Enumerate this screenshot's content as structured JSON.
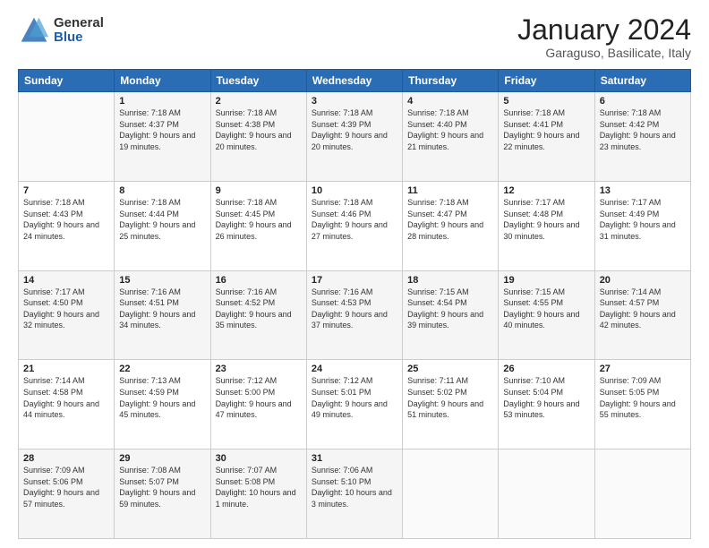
{
  "logo": {
    "general": "General",
    "blue": "Blue"
  },
  "header": {
    "month": "January 2024",
    "location": "Garaguso, Basilicate, Italy"
  },
  "weekdays": [
    "Sunday",
    "Monday",
    "Tuesday",
    "Wednesday",
    "Thursday",
    "Friday",
    "Saturday"
  ],
  "weeks": [
    [
      {
        "day": "",
        "sunrise": "",
        "sunset": "",
        "daylight": ""
      },
      {
        "day": "1",
        "sunrise": "Sunrise: 7:18 AM",
        "sunset": "Sunset: 4:37 PM",
        "daylight": "Daylight: 9 hours and 19 minutes."
      },
      {
        "day": "2",
        "sunrise": "Sunrise: 7:18 AM",
        "sunset": "Sunset: 4:38 PM",
        "daylight": "Daylight: 9 hours and 20 minutes."
      },
      {
        "day": "3",
        "sunrise": "Sunrise: 7:18 AM",
        "sunset": "Sunset: 4:39 PM",
        "daylight": "Daylight: 9 hours and 20 minutes."
      },
      {
        "day": "4",
        "sunrise": "Sunrise: 7:18 AM",
        "sunset": "Sunset: 4:40 PM",
        "daylight": "Daylight: 9 hours and 21 minutes."
      },
      {
        "day": "5",
        "sunrise": "Sunrise: 7:18 AM",
        "sunset": "Sunset: 4:41 PM",
        "daylight": "Daylight: 9 hours and 22 minutes."
      },
      {
        "day": "6",
        "sunrise": "Sunrise: 7:18 AM",
        "sunset": "Sunset: 4:42 PM",
        "daylight": "Daylight: 9 hours and 23 minutes."
      }
    ],
    [
      {
        "day": "7",
        "sunrise": "Sunrise: 7:18 AM",
        "sunset": "Sunset: 4:43 PM",
        "daylight": "Daylight: 9 hours and 24 minutes."
      },
      {
        "day": "8",
        "sunrise": "Sunrise: 7:18 AM",
        "sunset": "Sunset: 4:44 PM",
        "daylight": "Daylight: 9 hours and 25 minutes."
      },
      {
        "day": "9",
        "sunrise": "Sunrise: 7:18 AM",
        "sunset": "Sunset: 4:45 PM",
        "daylight": "Daylight: 9 hours and 26 minutes."
      },
      {
        "day": "10",
        "sunrise": "Sunrise: 7:18 AM",
        "sunset": "Sunset: 4:46 PM",
        "daylight": "Daylight: 9 hours and 27 minutes."
      },
      {
        "day": "11",
        "sunrise": "Sunrise: 7:18 AM",
        "sunset": "Sunset: 4:47 PM",
        "daylight": "Daylight: 9 hours and 28 minutes."
      },
      {
        "day": "12",
        "sunrise": "Sunrise: 7:17 AM",
        "sunset": "Sunset: 4:48 PM",
        "daylight": "Daylight: 9 hours and 30 minutes."
      },
      {
        "day": "13",
        "sunrise": "Sunrise: 7:17 AM",
        "sunset": "Sunset: 4:49 PM",
        "daylight": "Daylight: 9 hours and 31 minutes."
      }
    ],
    [
      {
        "day": "14",
        "sunrise": "Sunrise: 7:17 AM",
        "sunset": "Sunset: 4:50 PM",
        "daylight": "Daylight: 9 hours and 32 minutes."
      },
      {
        "day": "15",
        "sunrise": "Sunrise: 7:16 AM",
        "sunset": "Sunset: 4:51 PM",
        "daylight": "Daylight: 9 hours and 34 minutes."
      },
      {
        "day": "16",
        "sunrise": "Sunrise: 7:16 AM",
        "sunset": "Sunset: 4:52 PM",
        "daylight": "Daylight: 9 hours and 35 minutes."
      },
      {
        "day": "17",
        "sunrise": "Sunrise: 7:16 AM",
        "sunset": "Sunset: 4:53 PM",
        "daylight": "Daylight: 9 hours and 37 minutes."
      },
      {
        "day": "18",
        "sunrise": "Sunrise: 7:15 AM",
        "sunset": "Sunset: 4:54 PM",
        "daylight": "Daylight: 9 hours and 39 minutes."
      },
      {
        "day": "19",
        "sunrise": "Sunrise: 7:15 AM",
        "sunset": "Sunset: 4:55 PM",
        "daylight": "Daylight: 9 hours and 40 minutes."
      },
      {
        "day": "20",
        "sunrise": "Sunrise: 7:14 AM",
        "sunset": "Sunset: 4:57 PM",
        "daylight": "Daylight: 9 hours and 42 minutes."
      }
    ],
    [
      {
        "day": "21",
        "sunrise": "Sunrise: 7:14 AM",
        "sunset": "Sunset: 4:58 PM",
        "daylight": "Daylight: 9 hours and 44 minutes."
      },
      {
        "day": "22",
        "sunrise": "Sunrise: 7:13 AM",
        "sunset": "Sunset: 4:59 PM",
        "daylight": "Daylight: 9 hours and 45 minutes."
      },
      {
        "day": "23",
        "sunrise": "Sunrise: 7:12 AM",
        "sunset": "Sunset: 5:00 PM",
        "daylight": "Daylight: 9 hours and 47 minutes."
      },
      {
        "day": "24",
        "sunrise": "Sunrise: 7:12 AM",
        "sunset": "Sunset: 5:01 PM",
        "daylight": "Daylight: 9 hours and 49 minutes."
      },
      {
        "day": "25",
        "sunrise": "Sunrise: 7:11 AM",
        "sunset": "Sunset: 5:02 PM",
        "daylight": "Daylight: 9 hours and 51 minutes."
      },
      {
        "day": "26",
        "sunrise": "Sunrise: 7:10 AM",
        "sunset": "Sunset: 5:04 PM",
        "daylight": "Daylight: 9 hours and 53 minutes."
      },
      {
        "day": "27",
        "sunrise": "Sunrise: 7:09 AM",
        "sunset": "Sunset: 5:05 PM",
        "daylight": "Daylight: 9 hours and 55 minutes."
      }
    ],
    [
      {
        "day": "28",
        "sunrise": "Sunrise: 7:09 AM",
        "sunset": "Sunset: 5:06 PM",
        "daylight": "Daylight: 9 hours and 57 minutes."
      },
      {
        "day": "29",
        "sunrise": "Sunrise: 7:08 AM",
        "sunset": "Sunset: 5:07 PM",
        "daylight": "Daylight: 9 hours and 59 minutes."
      },
      {
        "day": "30",
        "sunrise": "Sunrise: 7:07 AM",
        "sunset": "Sunset: 5:08 PM",
        "daylight": "Daylight: 10 hours and 1 minute."
      },
      {
        "day": "31",
        "sunrise": "Sunrise: 7:06 AM",
        "sunset": "Sunset: 5:10 PM",
        "daylight": "Daylight: 10 hours and 3 minutes."
      },
      {
        "day": "",
        "sunrise": "",
        "sunset": "",
        "daylight": ""
      },
      {
        "day": "",
        "sunrise": "",
        "sunset": "",
        "daylight": ""
      },
      {
        "day": "",
        "sunrise": "",
        "sunset": "",
        "daylight": ""
      }
    ]
  ]
}
